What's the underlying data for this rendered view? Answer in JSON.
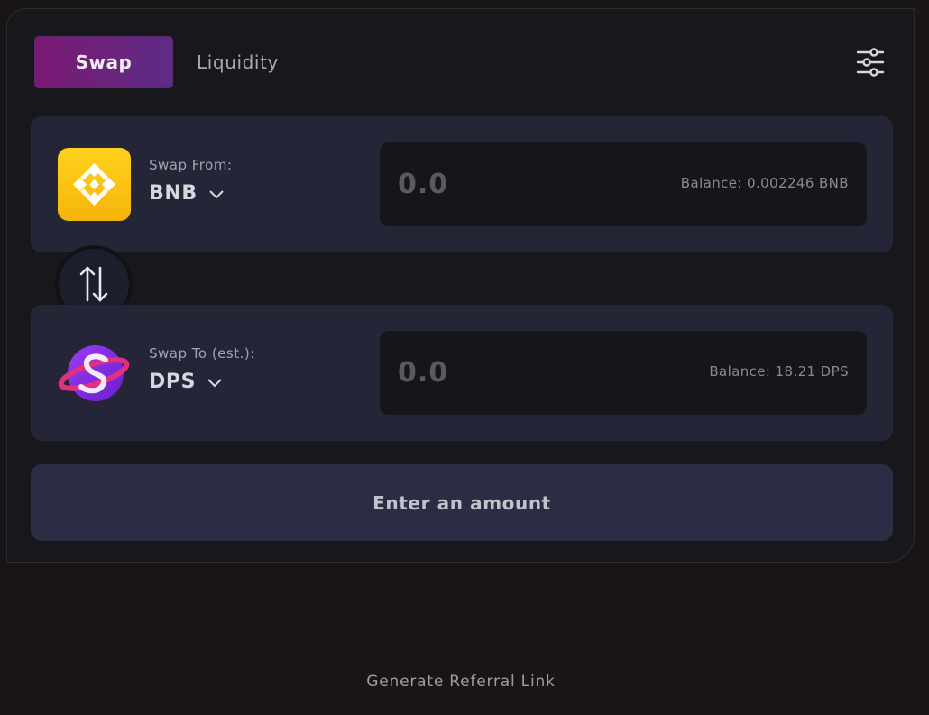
{
  "tabs": {
    "swap_label": "Swap",
    "liquidity_label": "Liquidity"
  },
  "settings": {
    "icon": "sliders-icon"
  },
  "swap_from": {
    "caption": "Swap From:",
    "token": "BNB",
    "token_icon": "bnb-logo-icon",
    "amount_placeholder": "0.0",
    "balance": "Balance: 0.002246 BNB"
  },
  "switch_button": {
    "icon": "swap-arrows-icon"
  },
  "swap_to": {
    "caption": "Swap To (est.):",
    "token": "DPS",
    "token_icon": "dps-logo-icon",
    "amount_placeholder": "0.0",
    "balance": "Balance: 18.21 DPS"
  },
  "submit": {
    "label": "Enter an amount"
  },
  "referral": {
    "label": "Generate Referral Link"
  },
  "colors": {
    "accent_gradient_start": "#7a1a74",
    "accent_gradient_end": "#5e2c84",
    "panel": "#242638",
    "bnb_yellow": "#f6b40b",
    "dps_purple": "#8a2be2"
  }
}
